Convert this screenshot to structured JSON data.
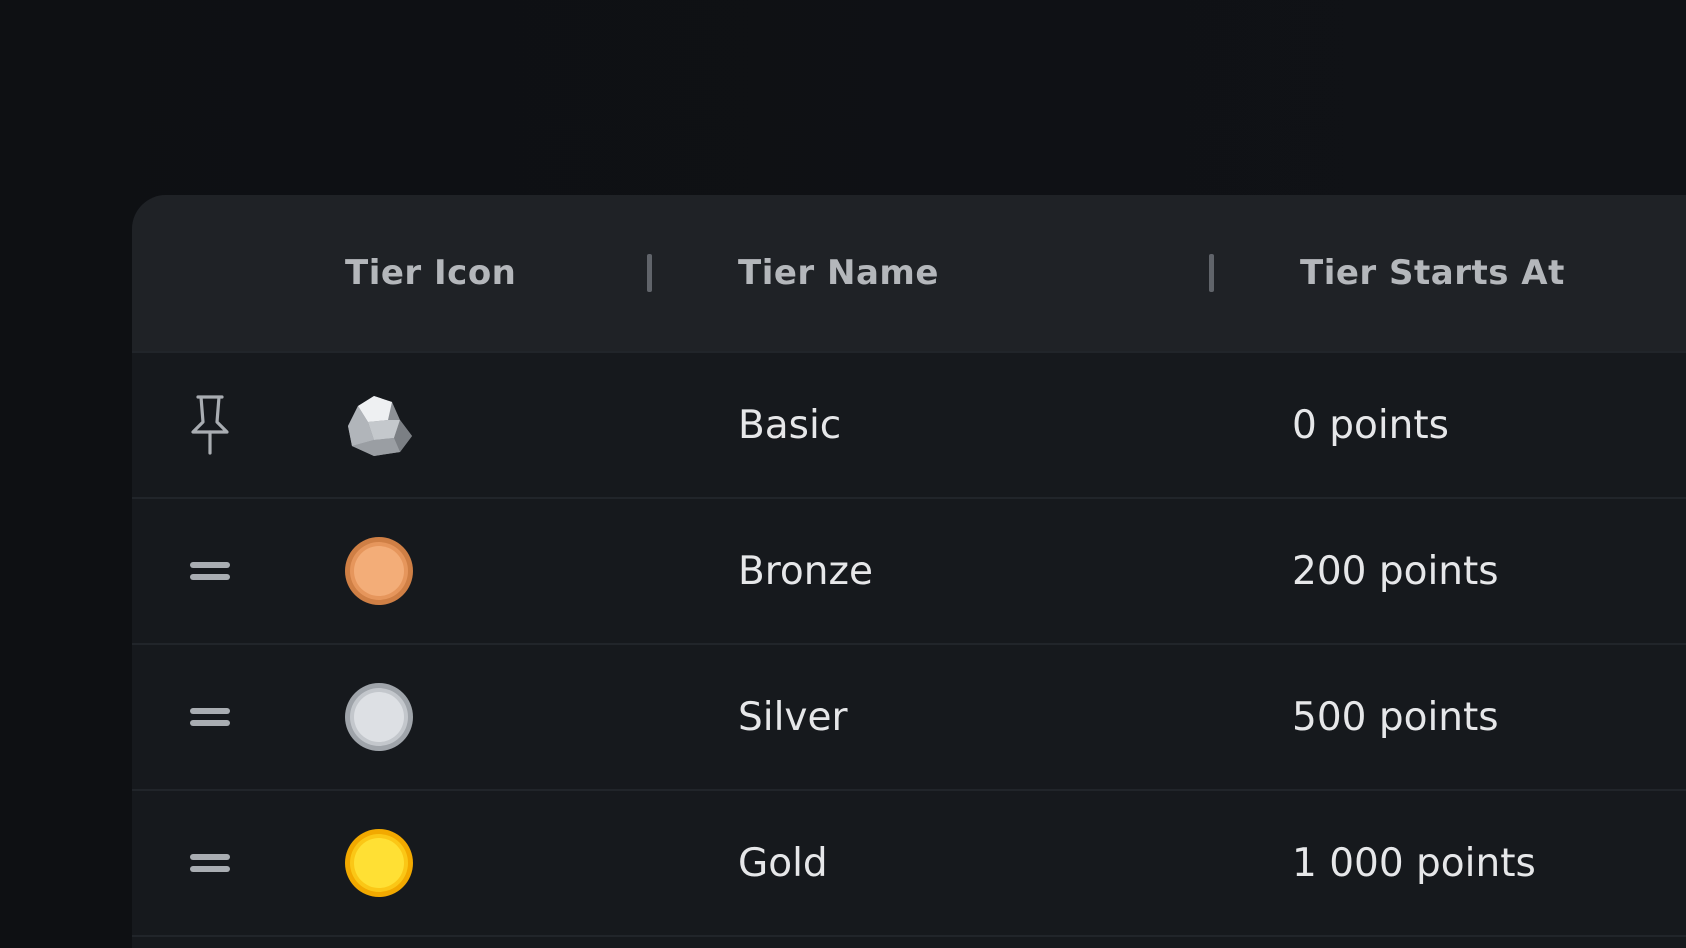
{
  "table": {
    "headers": {
      "icon": "Tier Icon",
      "name": "Tier Name",
      "starts_at": "Tier Starts At"
    },
    "rows": [
      {
        "handle": "pin-icon",
        "icon": "rock-icon",
        "name": "Basic",
        "starts_at": "0 points",
        "icon_color": "#c9ccd0"
      },
      {
        "handle": "drag-handle-icon",
        "icon": "bronze-coin-icon",
        "name": "Bronze",
        "starts_at": "200 points",
        "icon_color": "#e39a62"
      },
      {
        "handle": "drag-handle-icon",
        "icon": "silver-coin-icon",
        "name": "Silver",
        "starts_at": "500 points",
        "icon_color": "#c8ccd1"
      },
      {
        "handle": "drag-handle-icon",
        "icon": "gold-coin-icon",
        "name": "Gold",
        "starts_at": "1 000 points",
        "icon_color": "#f7c20e"
      }
    ]
  }
}
